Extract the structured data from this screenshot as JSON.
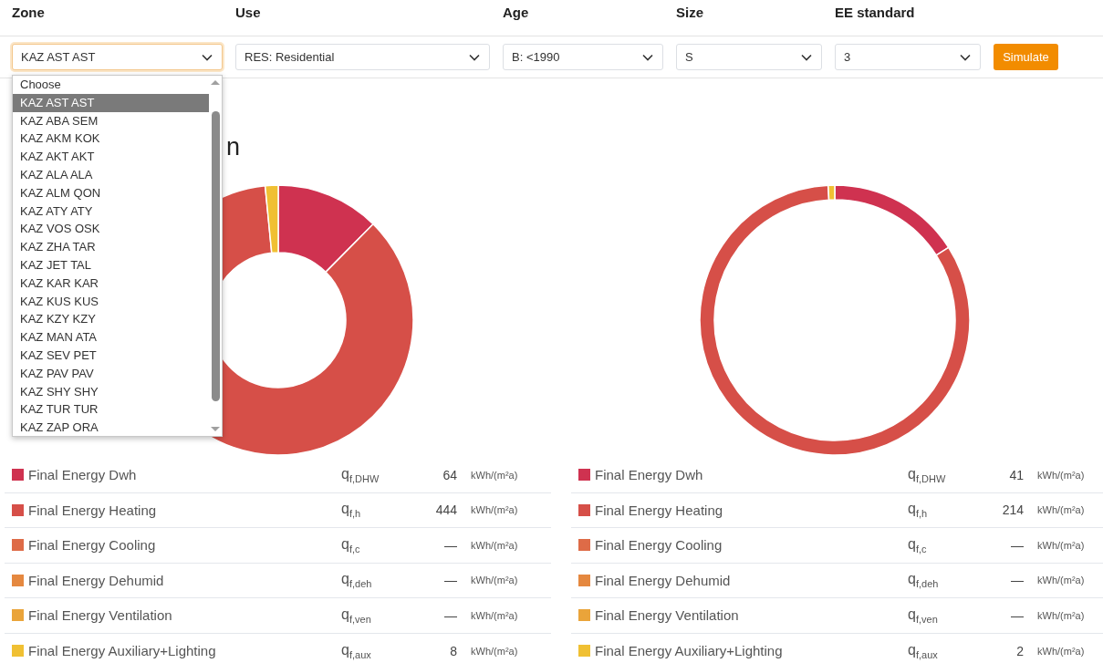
{
  "filters": [
    {
      "label": "Zone",
      "value": "KAZ AST AST",
      "focused": true
    },
    {
      "label": "Use",
      "value": "RES: Residential",
      "focused": false
    },
    {
      "label": "Age",
      "value": "B: <1990",
      "focused": false
    },
    {
      "label": "Size",
      "value": "S",
      "focused": false
    },
    {
      "label": "EE standard",
      "value": "3",
      "focused": false
    }
  ],
  "simulate_button": "Simulate",
  "zone_dropdown": {
    "options": [
      {
        "label": "Choose",
        "selected": false
      },
      {
        "label": "KAZ AST AST",
        "selected": true
      },
      {
        "label": "KAZ ABA SEM",
        "selected": false
      },
      {
        "label": "KAZ AKM KOK",
        "selected": false
      },
      {
        "label": "KAZ AKT AKT",
        "selected": false
      },
      {
        "label": "KAZ ALA ALA",
        "selected": false
      },
      {
        "label": "KAZ ALM QON",
        "selected": false
      },
      {
        "label": "KAZ ATY ATY",
        "selected": false
      },
      {
        "label": "KAZ VOS OSK",
        "selected": false
      },
      {
        "label": "KAZ ZHA TAR",
        "selected": false
      },
      {
        "label": "KAZ JET TAL",
        "selected": false
      },
      {
        "label": "KAZ KAR KAR",
        "selected": false
      },
      {
        "label": "KAZ KUS KUS",
        "selected": false
      },
      {
        "label": "KAZ KZY KZY",
        "selected": false
      },
      {
        "label": "KAZ MAN ATA",
        "selected": false
      },
      {
        "label": "KAZ SEV PET",
        "selected": false
      },
      {
        "label": "KAZ PAV PAV",
        "selected": false
      },
      {
        "label": "KAZ SHY SHY",
        "selected": false
      },
      {
        "label": "KAZ TUR TUR",
        "selected": false
      },
      {
        "label": "KAZ ZAP ORA",
        "selected": false
      }
    ]
  },
  "heading_visible_part": "n",
  "results": [
    {
      "kind": "thick",
      "rows": [
        {
          "name": "Final Energy Dwh",
          "symbol": "q$_{f,DHW}$",
          "value": "64",
          "unit": "kWh/(m²a)",
          "color": "#cf3250"
        },
        {
          "name": "Final Energy Heating",
          "symbol": "q$_{f,h}$",
          "value": "444",
          "unit": "kWh/(m²a)",
          "color": "#d64f48"
        },
        {
          "name": "Final Energy Cooling",
          "symbol": "q$_{f,c}$",
          "value": "—",
          "unit": "kWh/(m²a)",
          "color": "#de6b47"
        },
        {
          "name": "Final Energy Dehumid",
          "symbol": "q$_{f,deh}$",
          "value": "—",
          "unit": "kWh/(m²a)",
          "color": "#e5883f"
        },
        {
          "name": "Final Energy Ventilation",
          "symbol": "q$_{f,ven}$",
          "value": "—",
          "unit": "kWh/(m²a)",
          "color": "#eaa43a"
        },
        {
          "name": "Final Energy Auxiliary+Lighting",
          "symbol": "q$_{f,aux}$",
          "value": "8",
          "unit": "kWh/(m²a)",
          "color": "#f0c033"
        }
      ]
    },
    {
      "kind": "thin",
      "rows": [
        {
          "name": "Final Energy Dwh",
          "symbol": "q$_{f,DHW}$",
          "value": "41",
          "unit": "kWh/(m²a)",
          "color": "#cf3250"
        },
        {
          "name": "Final Energy Heating",
          "symbol": "q$_{f,h}$",
          "value": "214",
          "unit": "kWh/(m²a)",
          "color": "#d64f48"
        },
        {
          "name": "Final Energy Cooling",
          "symbol": "q$_{f,c}$",
          "value": "—",
          "unit": "kWh/(m²a)",
          "color": "#de6b47"
        },
        {
          "name": "Final Energy Dehumid",
          "symbol": "q$_{f,deh}$",
          "value": "—",
          "unit": "kWh/(m²a)",
          "color": "#e5883f"
        },
        {
          "name": "Final Energy Ventilation",
          "symbol": "q$_{f,ven}$",
          "value": "—",
          "unit": "kWh/(m²a)",
          "color": "#eaa43a"
        },
        {
          "name": "Final Energy Auxiliary+Lighting",
          "symbol": "q$_{f,aux}$",
          "value": "2",
          "unit": "kWh/(m²a)",
          "color": "#f0c033"
        }
      ]
    }
  ]
}
